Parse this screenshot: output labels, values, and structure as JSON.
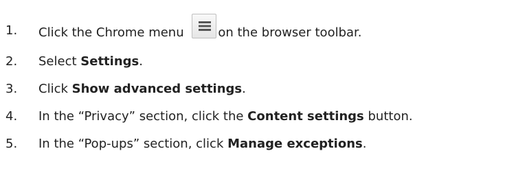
{
  "steps": [
    {
      "number": "1.",
      "before": "Click the Chrome menu ",
      "icon": "chrome-menu-icon",
      "after": "on the browser toolbar."
    },
    {
      "number": "2.",
      "before": "Select ",
      "bold": "Settings",
      "after": "."
    },
    {
      "number": "3.",
      "before": "Click ",
      "bold": "Show advanced settings",
      "after": "."
    },
    {
      "number": "4.",
      "before": "In the “Privacy” section, click the ",
      "bold": "Content settings",
      "after": " button."
    },
    {
      "number": "5.",
      "before": "In the “Pop-ups” section, click ",
      "bold": "Manage exceptions",
      "after": "."
    }
  ]
}
